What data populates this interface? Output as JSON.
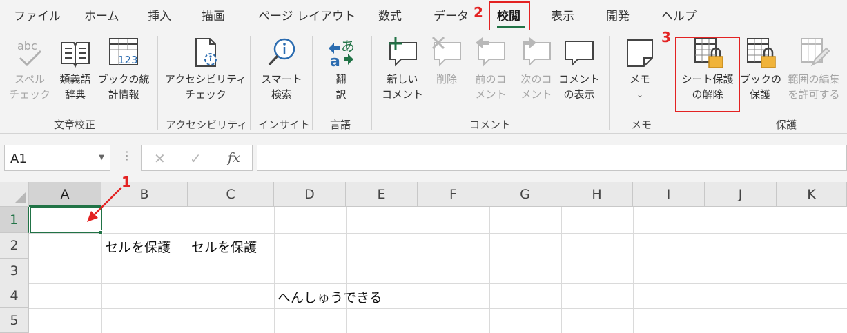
{
  "menu": {
    "tabs": [
      "ファイル",
      "ホーム",
      "挿入",
      "描画",
      "ページ レイアウト",
      "数式",
      "データ",
      "校閲",
      "表示",
      "開発",
      "ヘルプ"
    ],
    "active": "校閲"
  },
  "ribbon": {
    "spelling": [
      "スペル",
      "チェック"
    ],
    "thesaurus": [
      "類義語",
      "辞典"
    ],
    "workbook_stats": [
      "ブックの統",
      "計情報"
    ],
    "accessibility_check": [
      "アクセシビリティ",
      "チェック"
    ],
    "smart_lookup": [
      "スマート",
      "検索"
    ],
    "translate": [
      "翻",
      "訳"
    ],
    "new_comment": [
      "新しい",
      "コメント"
    ],
    "delete": [
      "削除"
    ],
    "previous_comment": [
      "前のコ",
      "メント"
    ],
    "next_comment": [
      "次のコ",
      "メント"
    ],
    "show_comments": [
      "コメント",
      "の表示"
    ],
    "notes": [
      "メモ"
    ],
    "unprotect_sheet": [
      "シート保護",
      "の解除"
    ],
    "protect_workbook": [
      "ブックの",
      "保護"
    ],
    "allow_edit_ranges": [
      "範囲の編集",
      "を許可する"
    ],
    "groups": {
      "proofing": "文章校正",
      "accessibility": "アクセシビリティ",
      "insights": "インサイト",
      "language": "言語",
      "comments": "コメント",
      "notes": "メモ",
      "protect": "保護"
    }
  },
  "annotations": {
    "n1": "1",
    "n2": "2",
    "n3": "3"
  },
  "formula_bar": {
    "name_box": "A1",
    "fx": "fx",
    "cancel": "✕",
    "enter": "✓",
    "value": ""
  },
  "sheet": {
    "columns": [
      "A",
      "B",
      "C",
      "D",
      "E",
      "F",
      "G",
      "H",
      "I",
      "J",
      "K"
    ],
    "rows": [
      "1",
      "2",
      "3",
      "4",
      "5"
    ],
    "cells": {
      "B2": "セルを保護",
      "C2": "セルを保護",
      "D4": "へんしゅうできる"
    },
    "active_cell": "A1"
  }
}
